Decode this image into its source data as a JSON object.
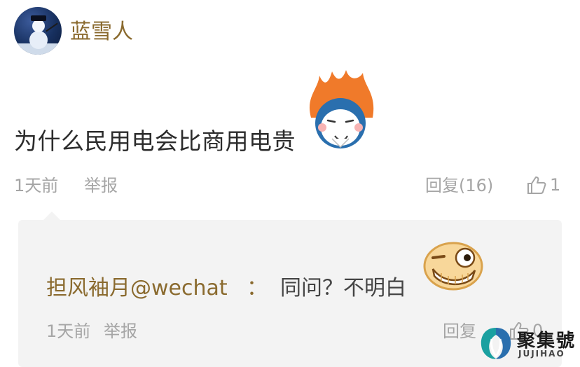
{
  "post": {
    "username": "蓝雪人",
    "text": "为什么民用电会比商用电贵",
    "time": "1天前",
    "report_label": "举报",
    "reply_label": "回复(16)",
    "like_count": "1"
  },
  "reply": {
    "author": "担风袖月@wechat",
    "colon": "：",
    "text": "同问？不明白",
    "time": "1天前",
    "report_label": "举报",
    "reply_label": "回复",
    "like_count": "0"
  },
  "watermark": {
    "name": "聚集號",
    "name_en": "JUJIHAO"
  },
  "colors": {
    "username": "#8a6a2e",
    "meta": "#a5a5a5",
    "reply_bg": "#f3f3f3"
  }
}
